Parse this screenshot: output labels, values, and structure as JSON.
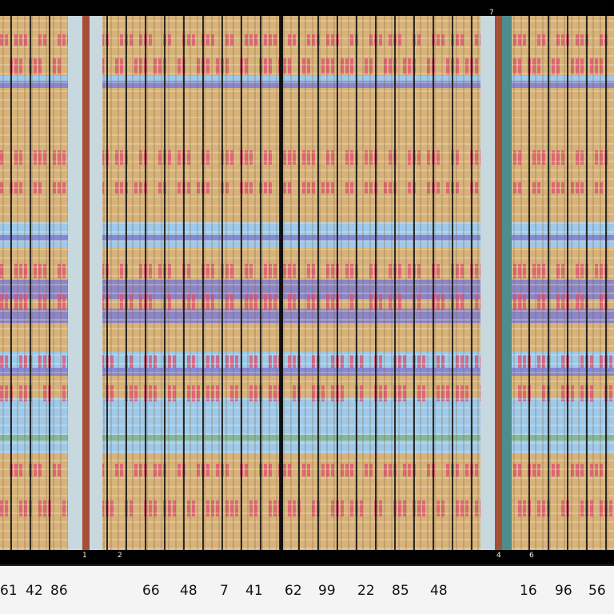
{
  "bottom_ruler": {
    "labels": [
      "61",
      "42",
      "86",
      "66",
      "48",
      "7",
      "41",
      "62",
      "99",
      "22",
      "85",
      "48",
      "16",
      "96",
      "56"
    ]
  },
  "marker_labels": [
    "1",
    "2",
    "4",
    "6",
    "7"
  ],
  "colors": {
    "background": "#000000",
    "grid_fill": "#d7b37a",
    "band_blue": "#9ec9ea",
    "band_violet": "#7f7ed2",
    "band_pink": "#e24e73",
    "band_green": "#7fb88c",
    "divider_rust": "#a44f36",
    "divider_teal": "#4f8d8d",
    "ruler_bg": "#f4f4f4"
  }
}
